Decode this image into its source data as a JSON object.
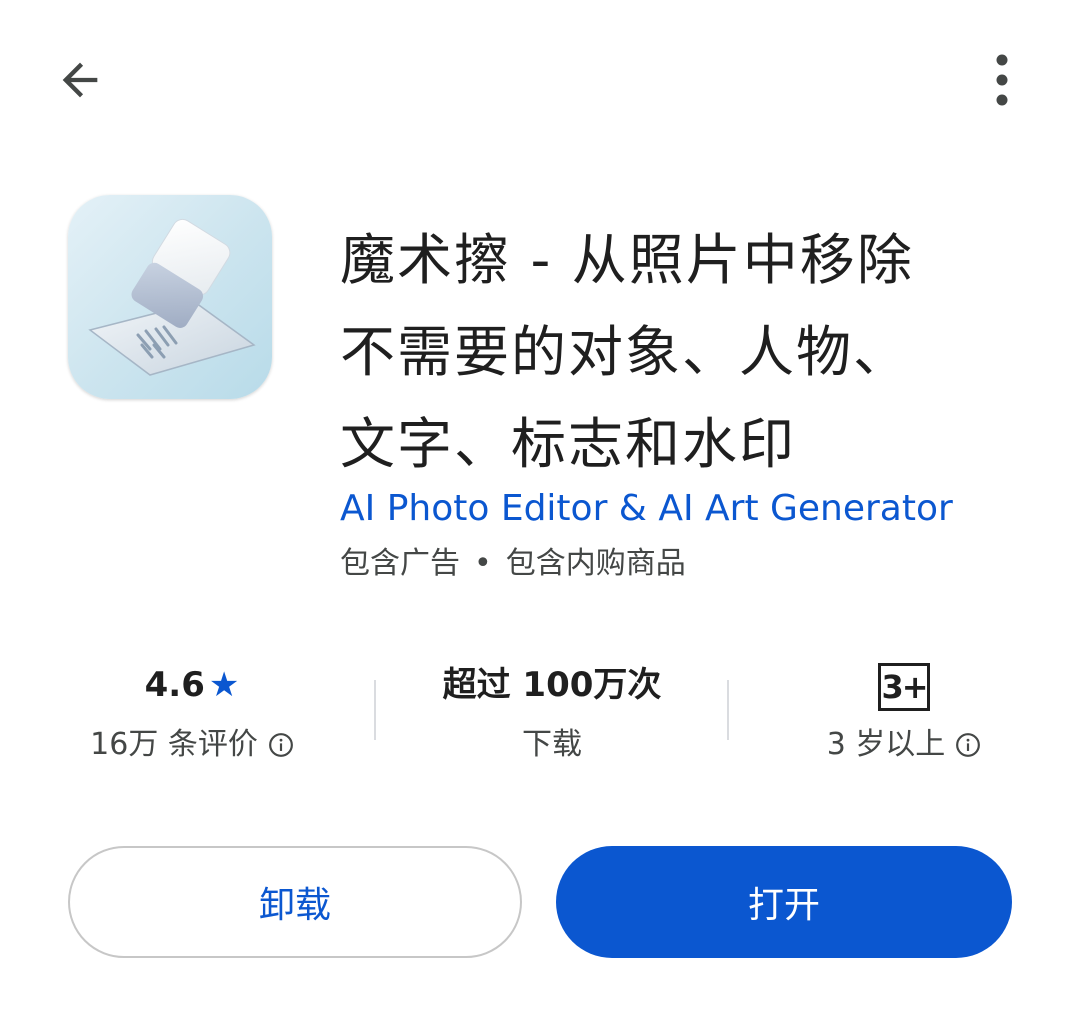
{
  "app": {
    "title_lines": [
      "魔术擦 - 从照片中移除",
      "不需要的对象、人物、",
      "文字、标志和水印"
    ],
    "developer": "AI Photo Editor & AI Art Generator",
    "meta": {
      "ads": "包含广告",
      "separator": "•",
      "iap": "包含内购商品"
    }
  },
  "stats": {
    "rating": {
      "value": "4.6",
      "star": "★",
      "label": "16万 条评价"
    },
    "downloads": {
      "value": "超过 100万次",
      "label": "下载"
    },
    "age": {
      "badge": "3+",
      "label": "3 岁以上"
    }
  },
  "buttons": {
    "uninstall": "卸载",
    "open": "打开"
  },
  "icons": {
    "back": "arrow-back-icon",
    "more": "more-vert-icon",
    "info": "info-icon",
    "app_icon": "eraser-app-icon"
  },
  "colors": {
    "accent": "#0b57d0",
    "text": "#1f1f1f",
    "secondary_text": "#444746",
    "divider": "#dadce0",
    "button_outline": "#c7c7c7"
  }
}
